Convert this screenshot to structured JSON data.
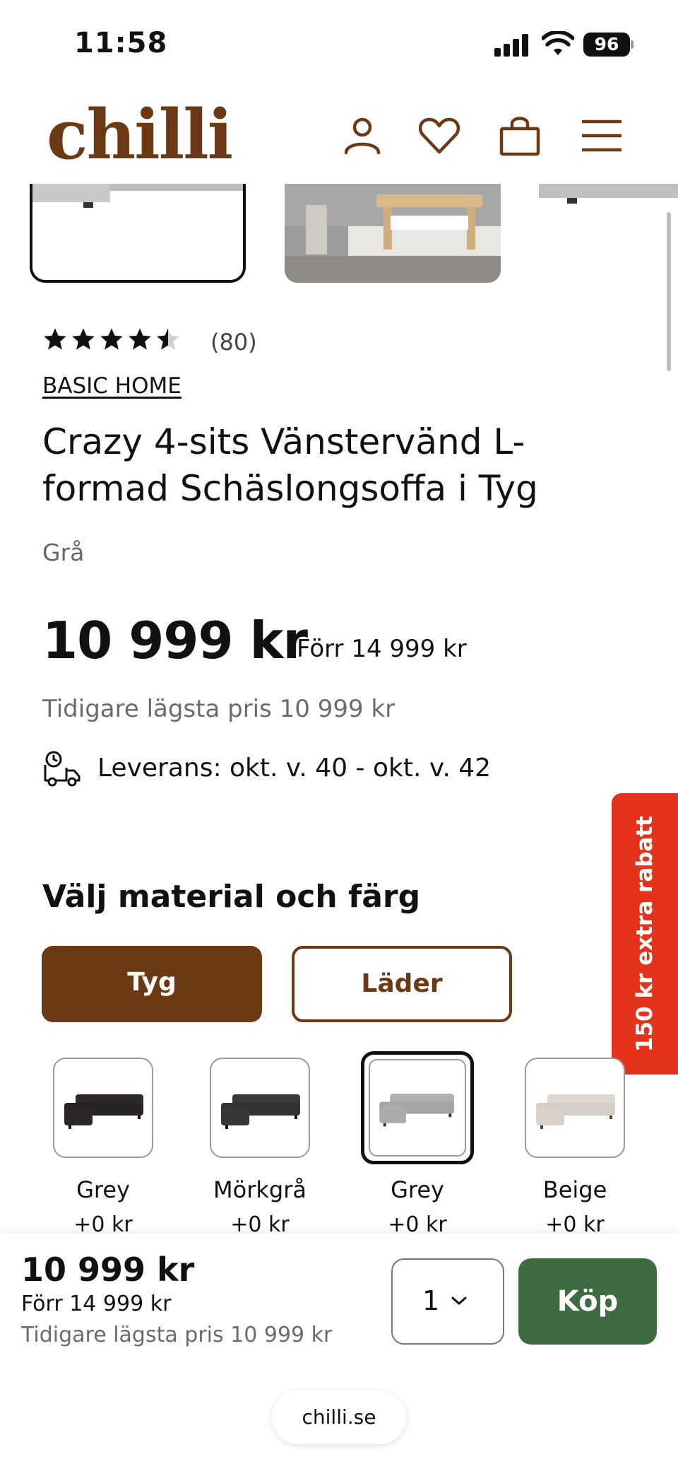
{
  "status_bar": {
    "time": "11:58",
    "battery": "96"
  },
  "header": {
    "logo": "chilli",
    "icons": [
      "account-icon",
      "heart-icon",
      "cart-icon",
      "menu-icon"
    ],
    "brand_color": "#6b3a15"
  },
  "gallery": {
    "selected_index": 0,
    "thumbnail_count": 3
  },
  "product": {
    "rating": 4.5,
    "reviews": "(80)",
    "brand": "BASIC HOME",
    "title": "Crazy 4-sits Vänstervänd L-formad Schäslongsoffa i Tyg",
    "color": "Grå",
    "price": "10 999 kr",
    "previous_price": "Förr 14 999 kr",
    "lowest_price": "Tidigare lägsta pris 10 999 kr",
    "delivery": "Leverans: okt. v. 40 - okt. v. 42"
  },
  "promo_banner": {
    "text": "150 kr extra rabatt",
    "color": "#e4331a"
  },
  "materials": {
    "title": "Välj material och färg",
    "options": [
      {
        "label": "Tyg",
        "active": true
      },
      {
        "label": "Läder",
        "active": false
      }
    ],
    "swatches": [
      {
        "name": "Grey",
        "price": "+0 kr",
        "tone": "#2e2a29",
        "selected": false
      },
      {
        "name": "Mörkgrå",
        "price": "+0 kr",
        "tone": "#3a3a3c",
        "selected": false
      },
      {
        "name": "Grey",
        "price": "+0 kr",
        "tone": "#a9a9ab",
        "selected": true
      },
      {
        "name": "Beige",
        "price": "+0 kr",
        "tone": "#d9d3cb",
        "selected": false
      }
    ]
  },
  "bottom_bar": {
    "price": "10 999 kr",
    "previous_price": "Förr 14 999 kr",
    "lowest_price": "Tidigare lägsta pris 10 999 kr",
    "quantity": "1",
    "buy_label": "Köp",
    "buy_color": "#3f6b43",
    "url": "chilli.se"
  }
}
